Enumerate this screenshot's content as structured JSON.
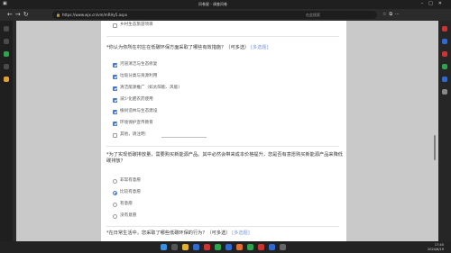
{
  "browser": {
    "window_title": "问卷星 - 调查问卷",
    "url": "https://www.wjx.cn/vm/mRHy5.aspx",
    "search_placeholder": "在此搜索"
  },
  "survey": {
    "top_option": "乡村生态旅游项目",
    "q1": {
      "title": "*你认为你所在村庄在低碳环保方面采取了哪些有效措施？（可多选）",
      "tag": "[多选题]",
      "options": [
        {
          "label": "河道清洁与生态修复",
          "checked": true
        },
        {
          "label": "垃圾分类与资源利用",
          "checked": true
        },
        {
          "label": "清洁能源推广（如太阳能、风能）",
          "checked": true
        },
        {
          "label": "减少化肥农药使用",
          "checked": true
        },
        {
          "label": "植树造林与生态建设",
          "checked": true
        },
        {
          "label": "环境保护宣传教育",
          "checked": true
        },
        {
          "label": "其他，请注明:",
          "checked": false
        }
      ]
    },
    "q2": {
      "title": "*为了实现低碳排放量，需要购买新能源产品。其中必然会带来成本价格提升，您是否有意愿购买新能源产品来降低碳排放？",
      "options": [
        {
          "label": "非常有意愿",
          "selected": false
        },
        {
          "label": "比较有意愿",
          "selected": true
        },
        {
          "label": "有意愿",
          "selected": false
        },
        {
          "label": "没有意愿",
          "selected": false
        }
      ]
    },
    "q3": {
      "title": "*在日常生活中，您采取了哪些低碳环保的行为？（可多选）",
      "tag": "[多选题]"
    }
  },
  "taskbar": {
    "time": "17:45",
    "date": "2024/6/19"
  },
  "colors": {
    "accent": "#3d78d8",
    "card_bg": "#ffffff",
    "page_bg": "#c9c9c9"
  }
}
